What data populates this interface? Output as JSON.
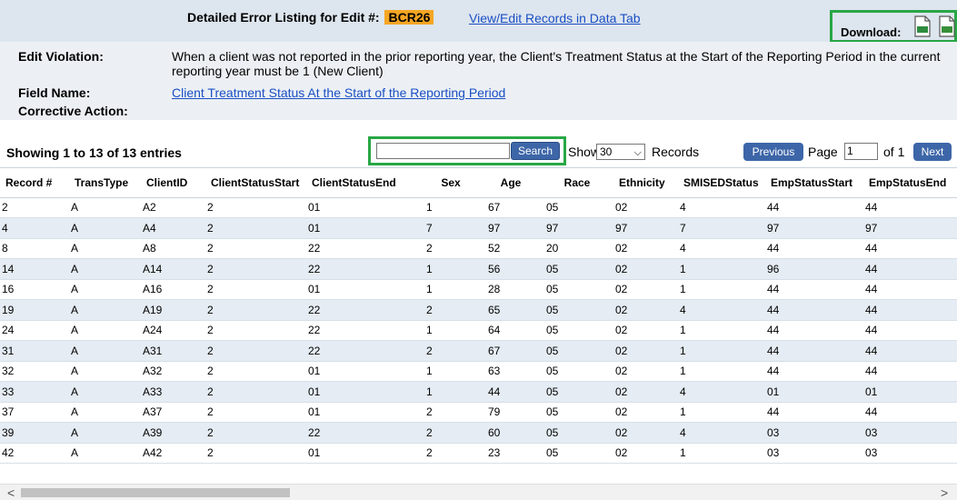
{
  "header": {
    "title": "Detailed Error Listing for Edit #:",
    "edit_code": "BCR26",
    "view_link": "View/Edit Records in Data Tab",
    "download_label": "Download:",
    "xls_label": "XLS",
    "csv_label": "CSV"
  },
  "info": {
    "violation_label": "Edit Violation:",
    "violation_text": "When a client was not reported in the prior reporting year, the Client's Treatment Status at the Start of the Reporting Period in the current reporting year must be 1 (New Client)",
    "field_label": "Field Name:",
    "field_link": "Client Treatment Status At the Start of the Reporting Period",
    "corrective_label": "Corrective Action:"
  },
  "controls": {
    "showing": "Showing 1 to 13 of 13 entries",
    "search_value": "",
    "search_button": "Search",
    "show_label": "Show",
    "show_value": "30",
    "records_label": "Records",
    "previous": "Previous",
    "page_label": "Page",
    "page_value": "1",
    "of_label": "of 1",
    "next": "Next"
  },
  "table": {
    "columns": [
      "Record #",
      "TransType",
      "ClientID",
      "ClientStatusStart",
      "ClientStatusEnd",
      "Sex",
      "Age",
      "Race",
      "Ethnicity",
      "SMISEDStatus",
      "EmpStatusStart",
      "EmpStatusEnd"
    ],
    "rows": [
      [
        "2",
        "A",
        "A2",
        "2",
        "01",
        "1",
        "67",
        "05",
        "02",
        "4",
        "44",
        "44"
      ],
      [
        "4",
        "A",
        "A4",
        "2",
        "01",
        "7",
        "97",
        "97",
        "97",
        "7",
        "97",
        "97"
      ],
      [
        "8",
        "A",
        "A8",
        "2",
        "22",
        "2",
        "52",
        "20",
        "02",
        "4",
        "44",
        "44"
      ],
      [
        "14",
        "A",
        "A14",
        "2",
        "22",
        "1",
        "56",
        "05",
        "02",
        "1",
        "96",
        "44"
      ],
      [
        "16",
        "A",
        "A16",
        "2",
        "01",
        "1",
        "28",
        "05",
        "02",
        "1",
        "44",
        "44"
      ],
      [
        "19",
        "A",
        "A19",
        "2",
        "22",
        "2",
        "65",
        "05",
        "02",
        "4",
        "44",
        "44"
      ],
      [
        "24",
        "A",
        "A24",
        "2",
        "22",
        "1",
        "64",
        "05",
        "02",
        "1",
        "44",
        "44"
      ],
      [
        "31",
        "A",
        "A31",
        "2",
        "22",
        "2",
        "67",
        "05",
        "02",
        "1",
        "44",
        "44"
      ],
      [
        "32",
        "A",
        "A32",
        "2",
        "01",
        "1",
        "63",
        "05",
        "02",
        "1",
        "44",
        "44"
      ],
      [
        "33",
        "A",
        "A33",
        "2",
        "01",
        "1",
        "44",
        "05",
        "02",
        "4",
        "01",
        "01"
      ],
      [
        "37",
        "A",
        "A37",
        "2",
        "01",
        "2",
        "79",
        "05",
        "02",
        "1",
        "44",
        "44"
      ],
      [
        "39",
        "A",
        "A39",
        "2",
        "22",
        "2",
        "60",
        "05",
        "02",
        "4",
        "03",
        "03"
      ],
      [
        "42",
        "A",
        "A42",
        "2",
        "01",
        "2",
        "23",
        "05",
        "02",
        "1",
        "03",
        "03"
      ]
    ]
  },
  "scrollbar": {
    "left_arrow": "<",
    "right_arrow": ">"
  },
  "colors": {
    "header_bg": "#dde5ee",
    "info_bg": "#ecf0f4",
    "accent_orange": "#f5a623",
    "highlight_green": "#28a745",
    "button_blue": "#3d66a8",
    "link_blue": "#1a4fc4",
    "row_stripe": "#e5ecf3"
  },
  "icons": [
    "xls-file-icon",
    "csv-file-icon",
    "dropdown-caret-icon"
  ]
}
